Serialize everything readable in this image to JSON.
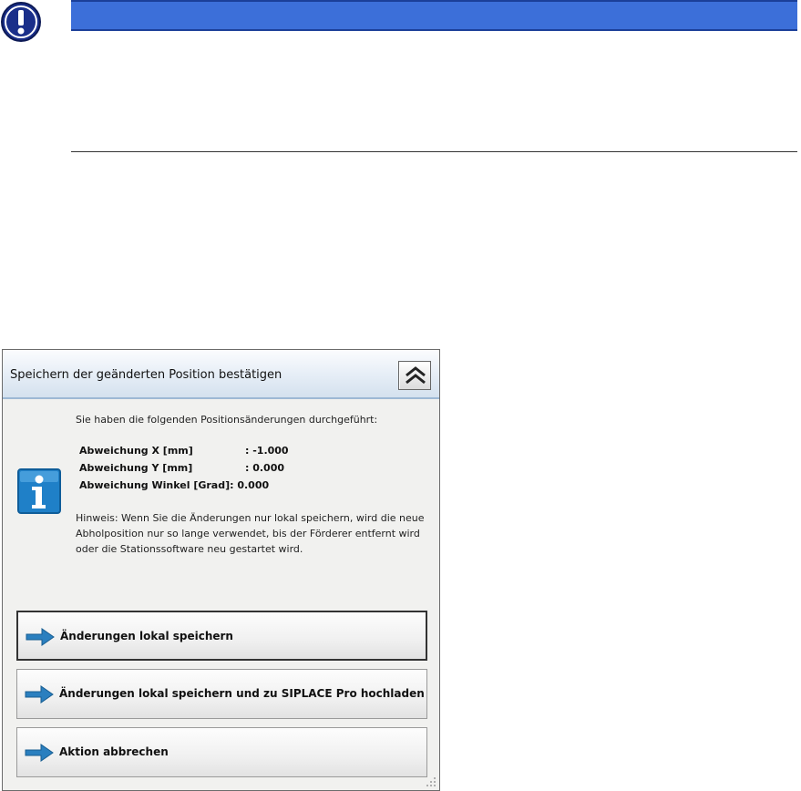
{
  "dialog": {
    "title": "Speichern der geänderten Position bestätigen",
    "intro": "Sie haben die folgenden Positionsänderungen durchgeführt:",
    "deviations": [
      {
        "label": "Abweichung X [mm]",
        "value": ": -1.000"
      },
      {
        "label": "Abweichung Y [mm]",
        "value": ": 0.000"
      },
      {
        "label": "Abweichung Winkel [Grad]",
        "value": ": 0.000"
      }
    ],
    "hint": "Hinweis: Wenn Sie die Änderungen nur lokal speichern, wird die neue Abholposition nur so lange verwendet, bis der Förderer entfernt wird oder die Stationssoftware neu gestartet wird.",
    "buttons": {
      "save_local": "Änderungen lokal speichern",
      "save_upload": "Änderungen lokal speichern und zu SIPLACE Pro hochladen",
      "cancel": "Aktion abbrechen"
    }
  },
  "colors": {
    "warning_bar": "#3c6fd9",
    "warning_icon": "#1a2f8a",
    "info_icon": "#1f80c8",
    "arrow": "#2a7fbf"
  },
  "icons": {
    "warning": "exclamation-circle-icon",
    "info": "info-icon",
    "collapse": "double-chevron-up-icon",
    "action": "arrow-right-icon"
  }
}
